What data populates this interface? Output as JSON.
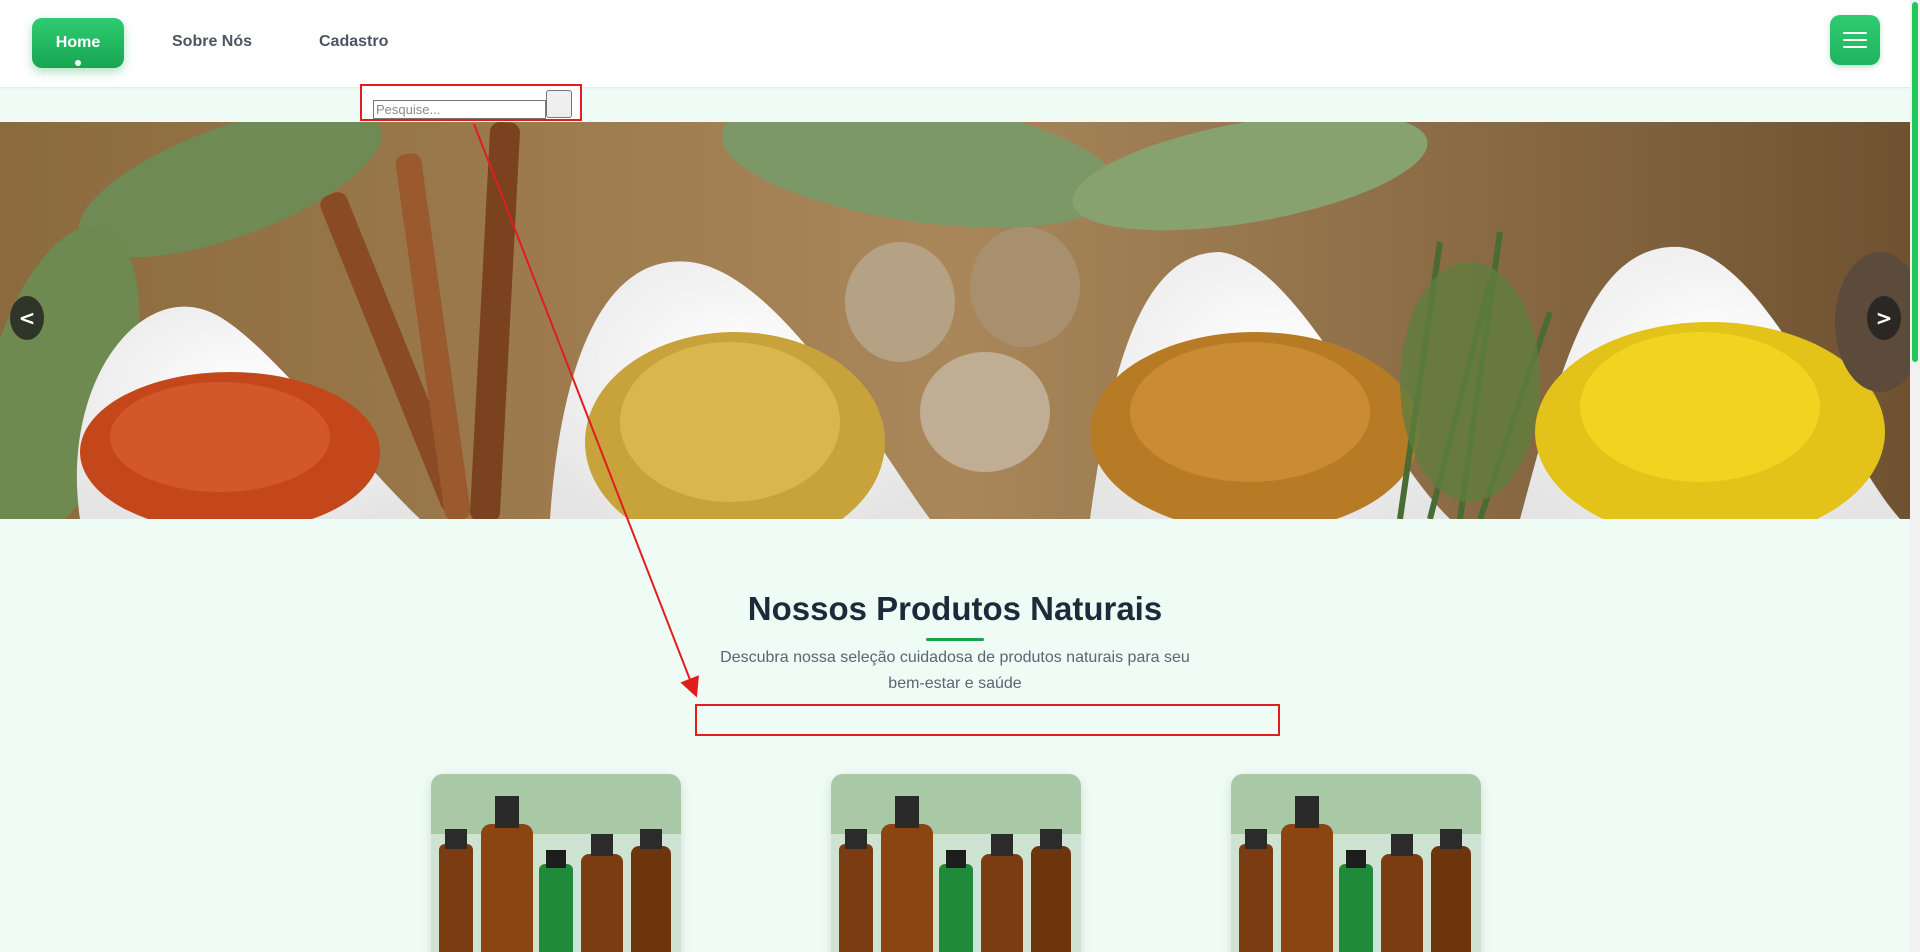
{
  "nav": {
    "home_label": "Home",
    "about_label": "Sobre Nós",
    "register_label": "Cadastro",
    "menu_icon": "hamburger-menu-icon"
  },
  "search": {
    "placeholder": "Pesquise...",
    "value": ""
  },
  "carousel": {
    "prev_label": "<",
    "next_label": ">"
  },
  "products_section": {
    "title": "Nossos Produtos Naturais",
    "subtitle": "Descubra nossa seleção cuidadosa de produtos naturais para seu bem-estar e saúde"
  },
  "colors": {
    "accent": "#22c55e",
    "accent_dark": "#16a34a",
    "annotation": "#e11d1d",
    "background": "#effcf5"
  }
}
